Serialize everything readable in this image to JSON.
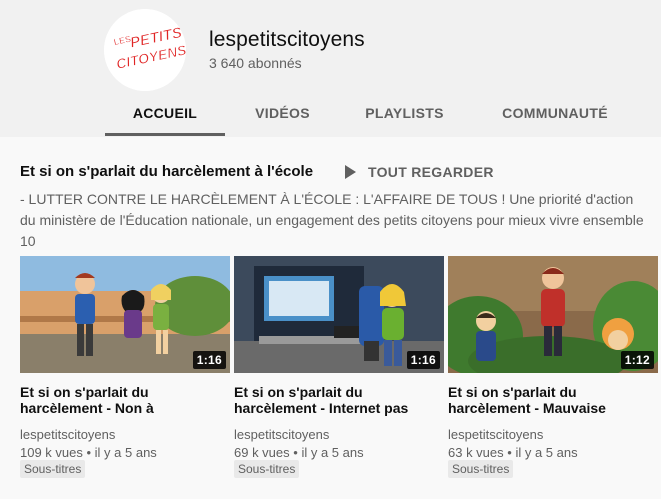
{
  "channel": {
    "name": "lespetitscitoyens",
    "subscribers": "3 640 abonnés",
    "logo_text": [
      "LES",
      "PETITS",
      "CITOYENS"
    ]
  },
  "tabs": [
    {
      "label": "ACCUEIL",
      "active": true
    },
    {
      "label": "VIDÉOS",
      "active": false
    },
    {
      "label": "PLAYLISTS",
      "active": false
    },
    {
      "label": "COMMUNAUTÉ",
      "active": false
    }
  ],
  "section": {
    "title": "Et si on s'parlait du harcèlement à l'école",
    "play_all": "TOUT REGARDER",
    "description": "- LUTTER CONTRE LE HARCÈLEMENT À L'ÉCOLE : L'AFFAIRE DE TOUS ! Une priorité d'action du ministère de l'Éducation nationale, un engagement des petits citoyens pour mieux vivre ensemble 10"
  },
  "videos": [
    {
      "title": "Et si on s'parlait du harcèlement - Non à",
      "duration": "1:16",
      "channel": "lespetitscitoyens",
      "views": "109 k vues",
      "age": "il y a 5 ans",
      "badge": "Sous-titres"
    },
    {
      "title": "Et si on s'parlait du harcèlement - Internet pas",
      "duration": "1:16",
      "channel": "lespetitscitoyens",
      "views": "69 k vues",
      "age": "il y a 5 ans",
      "badge": "Sous-titres"
    },
    {
      "title": "Et si on s'parlait du harcèlement - Mauvaise",
      "duration": "1:12",
      "channel": "lespetitscitoyens",
      "views": "63 k vues",
      "age": "il y a 5 ans",
      "badge": "Sous-titres"
    }
  ],
  "meta_separator": " • ",
  "colors": {
    "header_bg": "#f1f1f1",
    "page_bg": "#f9f9f9",
    "logo_red": "#e02424",
    "secondary_text": "#606060"
  }
}
